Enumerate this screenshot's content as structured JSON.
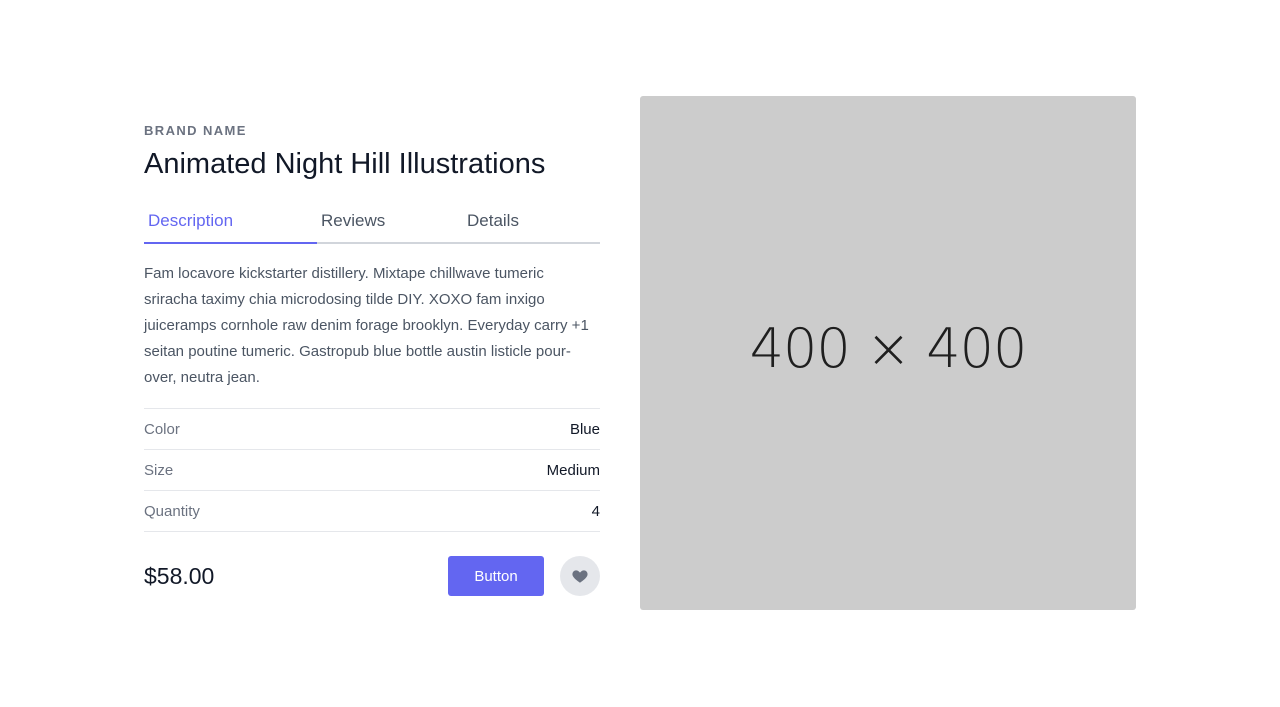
{
  "product": {
    "brand": "BRAND NAME",
    "title": "Animated Night Hill Illustrations",
    "tabs": [
      {
        "label": "Description"
      },
      {
        "label": "Reviews"
      },
      {
        "label": "Details"
      }
    ],
    "active_tab": "Description",
    "description": "Fam locavore kickstarter distillery. Mixtape chillwave tumeric sriracha taximy chia microdosing tilde DIY. XOXO fam inxigo juiceramps cornhole raw denim forage brooklyn. Everyday carry +1 seitan poutine tumeric. Gastropub blue bottle austin listicle pour-over, neutra jean.",
    "specs": [
      {
        "label": "Color",
        "value": "Blue"
      },
      {
        "label": "Size",
        "value": "Medium"
      },
      {
        "label": "Quantity",
        "value": "4"
      }
    ],
    "price": "$58.00",
    "buy_label": "Button",
    "favorite_icon": "heart-icon"
  },
  "image": {
    "placeholder": "400 × 400"
  },
  "colors": {
    "accent": "#6366f1",
    "image_bg": "#cccccc",
    "heading": "#111827",
    "muted": "#6b7280"
  }
}
